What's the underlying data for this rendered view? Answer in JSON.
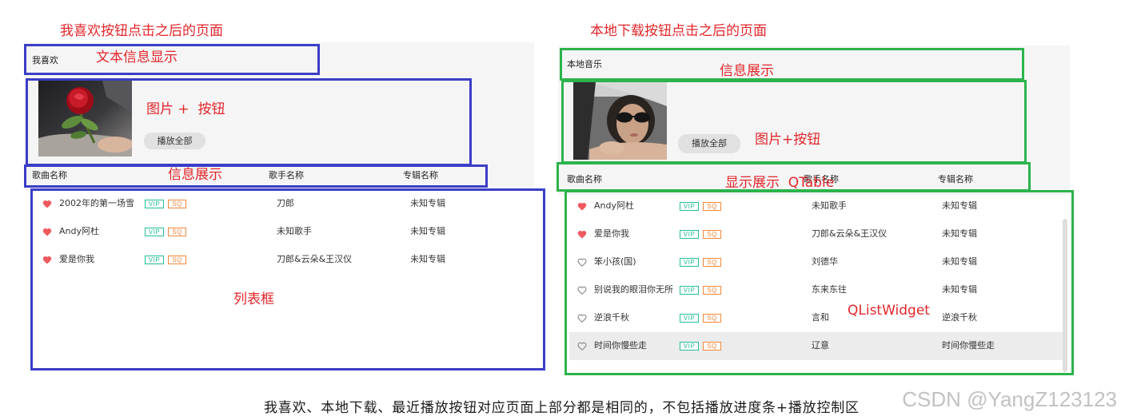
{
  "colors": {
    "annotation_red": "#e3262b",
    "left_frame_blue": "#3b3ec7",
    "right_frame_green": "#2cb34b",
    "heart_red": "#f05a5f",
    "vip_green": "#22bf98",
    "sq_orange": "#f2883a",
    "panel_gray": "#f5f5f5"
  },
  "icons": {
    "liked": "heart-filled-icon",
    "not_liked": "heart-outline-icon",
    "left_cover": "rose-photo-icon",
    "right_cover": "portrait-photo-icon"
  },
  "annotations": {
    "left_title": "我喜欢按钮点击之后的页面",
    "left_text_info": "文本信息显示",
    "left_image_button": "图片 +  按钮",
    "left_info_display": "信息展示",
    "left_list_box": "列表框",
    "right_title": "本地下载按钮点击之后的页面",
    "right_info_display": "信息展示",
    "right_image_button": "图片+按钮",
    "right_table": "显示展示  QTable",
    "right_list_widget": "QListWidget"
  },
  "left_page": {
    "page_title": "我喜欢",
    "play_all_label": "播放全部",
    "headers": {
      "song": "歌曲名称",
      "artist": "歌手名称",
      "album": "专辑名称"
    },
    "badges": {
      "vip": "VIP",
      "sq": "SQ"
    },
    "songs": [
      {
        "liked": true,
        "name": "2002年的第一场雪",
        "artist": "刀郎",
        "album": "未知专辑"
      },
      {
        "liked": true,
        "name": "Andy阿杜",
        "artist": "未知歌手",
        "album": "未知专辑"
      },
      {
        "liked": true,
        "name": "爱是你我",
        "artist": "刀郎&云朵&王汉仪",
        "album": "未知专辑"
      }
    ]
  },
  "right_page": {
    "page_title": "本地音乐",
    "play_all_label": "播放全部",
    "headers": {
      "song": "歌曲名称",
      "artist": "歌手名称",
      "album": "专辑名称"
    },
    "badges": {
      "vip": "VIP",
      "sq": "SQ"
    },
    "songs": [
      {
        "liked": true,
        "name": "Andy阿杜",
        "artist": "未知歌手",
        "album": "未知专辑",
        "hovered": false
      },
      {
        "liked": true,
        "name": "爱是你我",
        "artist": "刀郎&云朵&王汉仪",
        "album": "未知专辑",
        "hovered": false
      },
      {
        "liked": false,
        "name": "笨小孩(国)",
        "artist": "刘德华",
        "album": "未知专辑",
        "hovered": false
      },
      {
        "liked": false,
        "name": "别说我的眼泪你无所",
        "artist": "东来东往",
        "album": "未知专辑",
        "hovered": false
      },
      {
        "liked": false,
        "name": "逆浪千秋",
        "artist": "言和",
        "album": "逆浪千秋",
        "hovered": false
      },
      {
        "liked": false,
        "name": "时间你慢些走",
        "artist": "辽意",
        "album": "时间你慢些走",
        "hovered": true
      }
    ]
  },
  "caption": "我喜欢、本地下载、最近播放按钮对应页面上部分都是相同的，不包括播放进度条+播放控制区",
  "watermark": "CSDN @YangZ123123"
}
